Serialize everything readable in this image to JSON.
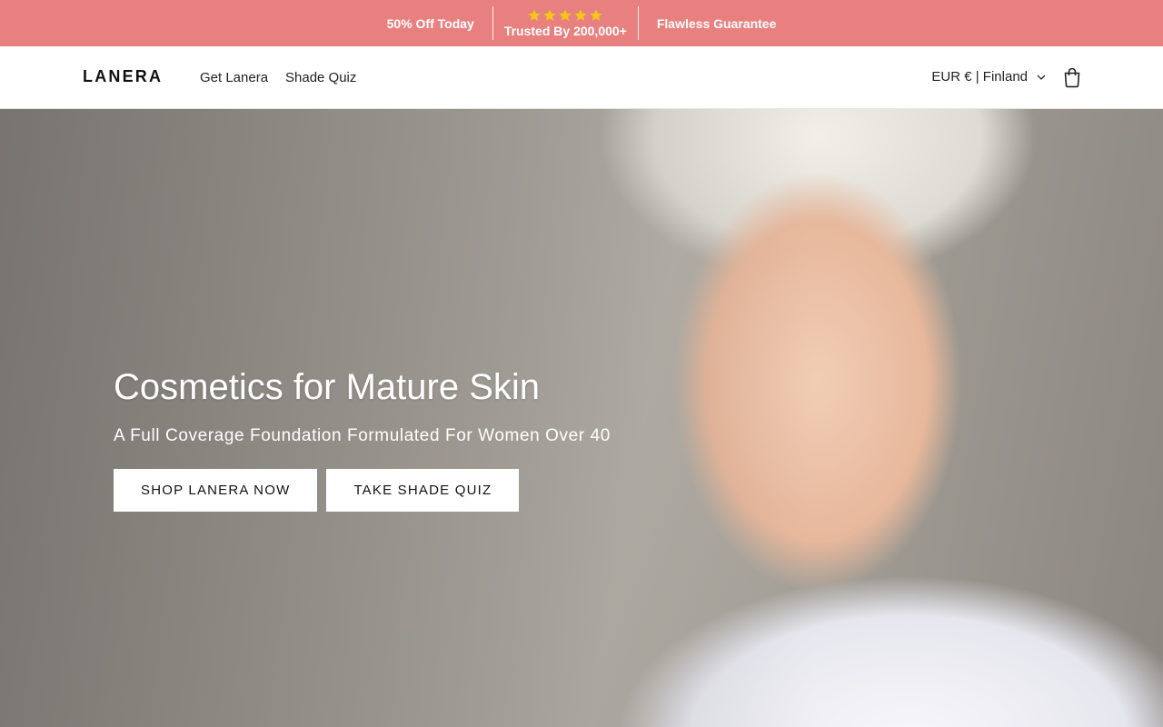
{
  "announcement": {
    "left": "50% Off Today",
    "stars_count": 5,
    "center": "Trusted By 200,000+",
    "right": "Flawless Guarantee",
    "background": "#e98080",
    "star_color": "#f5c518"
  },
  "header": {
    "logo": "LANERA",
    "nav": [
      "Get Lanera",
      "Shade Quiz"
    ],
    "currency": "EUR € | Finland",
    "cart_icon": "cart-icon"
  },
  "hero": {
    "title": "Cosmetics for Mature Skin",
    "subtitle": "A Full Coverage Foundation Formulated For Women Over 40",
    "buttons": [
      "SHOP LANERA NOW",
      "TAKE SHADE QUIZ"
    ]
  }
}
